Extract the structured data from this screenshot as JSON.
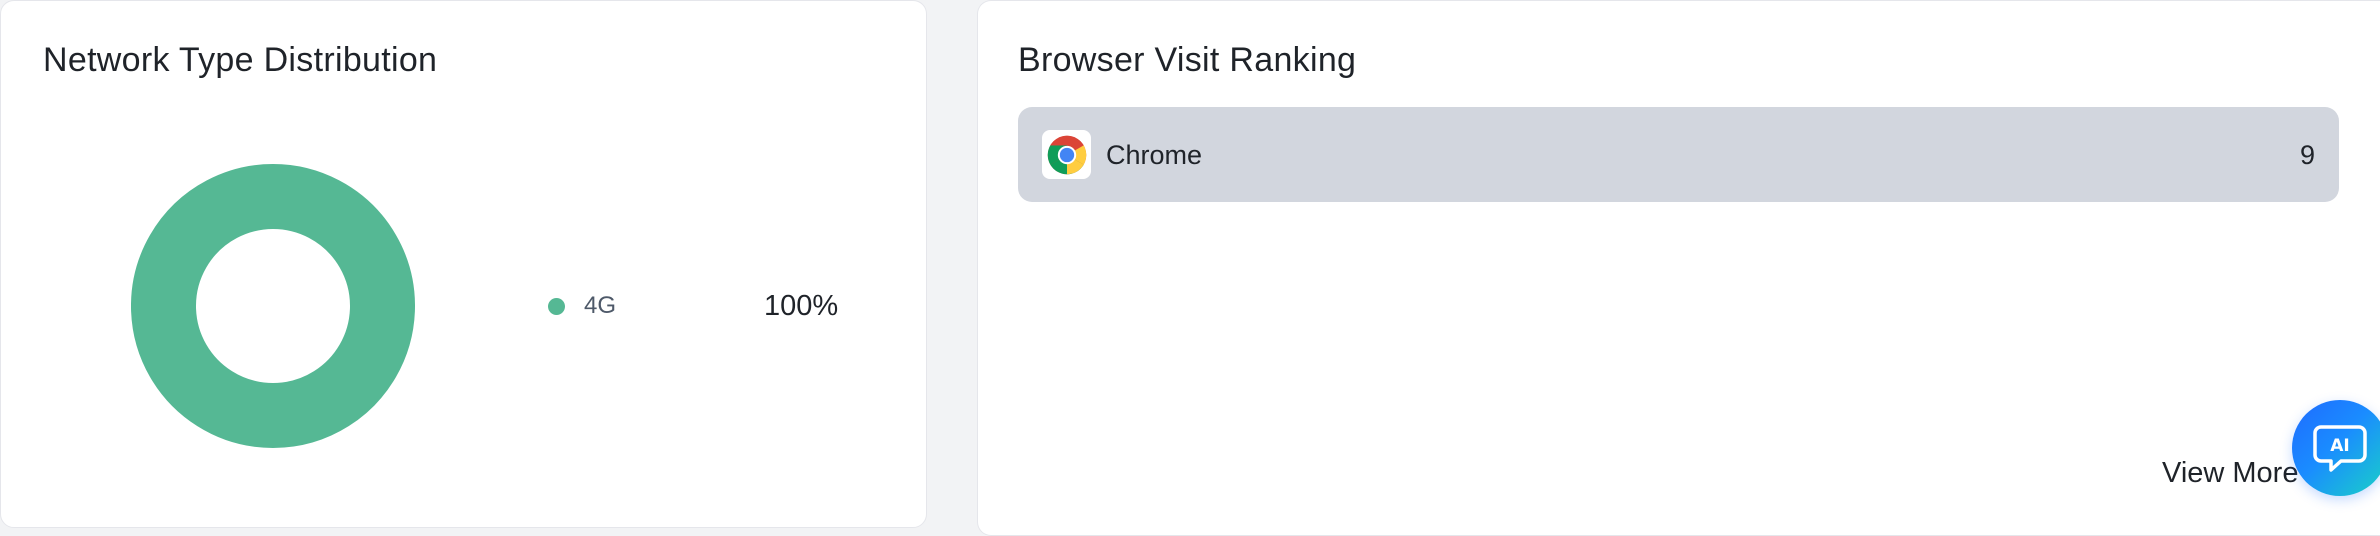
{
  "network": {
    "title": "Network Type Distribution",
    "legend": [
      {
        "label": "4G",
        "percent": "100%",
        "color": "#55b894"
      }
    ]
  },
  "chart_data": {
    "type": "pie",
    "categories": [
      "4G"
    ],
    "values": [
      100
    ],
    "donut": true,
    "colors": [
      "#55b894"
    ]
  },
  "browser": {
    "title": "Browser Visit Ranking",
    "items": [
      {
        "name": "Chrome",
        "count": "9",
        "icon": "chrome-icon"
      }
    ],
    "view_more": "View More"
  },
  "ai_button": {
    "label": "AI",
    "icon": "ai-chat-icon"
  }
}
